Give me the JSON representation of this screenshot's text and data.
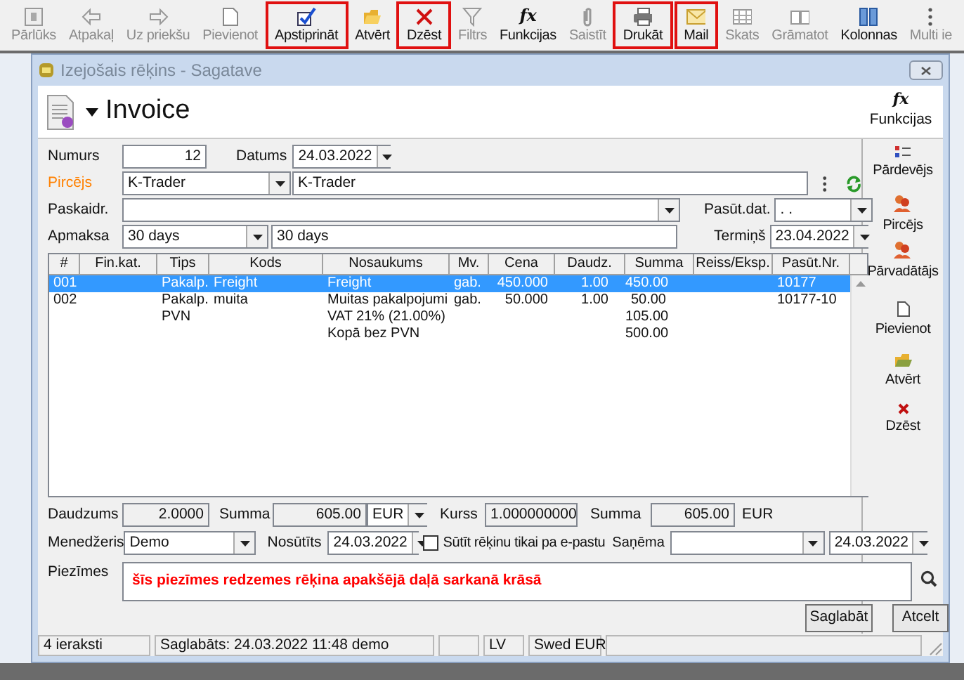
{
  "toolbar": [
    {
      "label": "Pārlūks",
      "disabled": true,
      "highlighted": false
    },
    {
      "label": "Atpakaļ",
      "disabled": true,
      "highlighted": false
    },
    {
      "label": "Uz priekšu",
      "disabled": true,
      "highlighted": false
    },
    {
      "label": "Pievienot",
      "disabled": true,
      "highlighted": false
    },
    {
      "label": "Apstiprināt",
      "disabled": false,
      "highlighted": true
    },
    {
      "label": "Atvērt",
      "disabled": false,
      "highlighted": false
    },
    {
      "label": "Dzēst",
      "disabled": false,
      "highlighted": true
    },
    {
      "label": "Filtrs",
      "disabled": true,
      "highlighted": false
    },
    {
      "label": "Funkcijas",
      "disabled": false,
      "highlighted": false,
      "glyph": "fx"
    },
    {
      "label": "Saistīt",
      "disabled": true,
      "highlighted": false
    },
    {
      "label": "Drukāt",
      "disabled": false,
      "highlighted": true
    },
    {
      "label": "Mail",
      "disabled": false,
      "highlighted": true
    },
    {
      "label": "Skats",
      "disabled": true,
      "highlighted": false
    },
    {
      "label": "Grāmatot",
      "disabled": true,
      "highlighted": false
    },
    {
      "label": "Kolonnas",
      "disabled": false,
      "highlighted": false
    },
    {
      "label": "Multi ie",
      "disabled": true,
      "highlighted": false
    }
  ],
  "window": {
    "title": "Izejošais rēķins  - Sagatave",
    "heading": "Invoice",
    "header_action": {
      "glyph": "fx",
      "label": "Funkcijas"
    }
  },
  "form": {
    "number": {
      "label": "Numurs",
      "value": "12"
    },
    "date": {
      "label": "Datums",
      "value": "24.03.2022"
    },
    "buyer": {
      "label": "Pircējs",
      "code": "K-Trader",
      "name": "K-Trader"
    },
    "explanation": {
      "label": "Paskaidr."
    },
    "order_date": {
      "label": "Pasūt.dat.",
      "value": ". ."
    },
    "payment": {
      "label": "Apmaksa",
      "code": "30 days",
      "text": "30 days"
    },
    "due": {
      "label": "Termiņš",
      "value": "23.04.2022"
    }
  },
  "table": {
    "columns": [
      "#",
      "Fin.kat.",
      "Tips",
      "Kods",
      "Nosaukums",
      "Mv.",
      "Cena",
      "Daudz.",
      "Summa",
      "Reiss/Eksp.",
      "Pasūt.Nr."
    ],
    "rows": [
      {
        "selected": true,
        "cells": [
          "001",
          null,
          "Pakalp.",
          "Freight",
          "Freight",
          "gab.",
          "450.000",
          "1.00",
          "450.00",
          null,
          "10177"
        ]
      },
      {
        "selected": false,
        "cells": [
          "002",
          null,
          "Pakalp.\nPVN",
          "muita",
          "Muitas pakalpojumi\nVAT 21% (21.00%)\nKopā bez PVN",
          "gab.",
          "50.000",
          "1.00",
          "50.00\n105.00\n500.00",
          null,
          "10177-10"
        ]
      }
    ]
  },
  "totals": {
    "quantity": {
      "label": "Daudzums",
      "value": "2.0000"
    },
    "sum": {
      "label": "Summa",
      "value": "605.00",
      "currency": "EUR"
    },
    "rate": {
      "label": "Kurss",
      "value": "1.000000000"
    },
    "sum_base": {
      "label": "Summa",
      "value": "605.00",
      "currency": "EUR"
    }
  },
  "manager": {
    "label": "Menedžeris",
    "value": "Demo"
  },
  "sent": {
    "label": "Nosūtīts",
    "value": "24.03.2022"
  },
  "email_only": {
    "label": "Sūtīt rēķinu tikai pa e-pastu",
    "checked": false
  },
  "received": {
    "label": "Saņēma",
    "date": "24.03.2022"
  },
  "notes": {
    "label": "Piezīmes",
    "value": "šīs piezīmes redzemes rēķina apakšējā daļā sarkanā krāsā"
  },
  "buttons": [
    "Saglabāt",
    "Atcelt"
  ],
  "sidebar": [
    {
      "label": "Pārdevējs"
    },
    {
      "label": "Pircējs"
    },
    {
      "label": "Pārvadātājs"
    },
    {
      "label": "Pievienot"
    },
    {
      "label": "Atvērt"
    },
    {
      "label": "Dzēst"
    }
  ],
  "status_bar": {
    "records": "4 ieraksti",
    "saved": "Saglabāts: 24.03.2022 11:48 demo",
    "language": "LV",
    "bank": "Swed EUR"
  }
}
